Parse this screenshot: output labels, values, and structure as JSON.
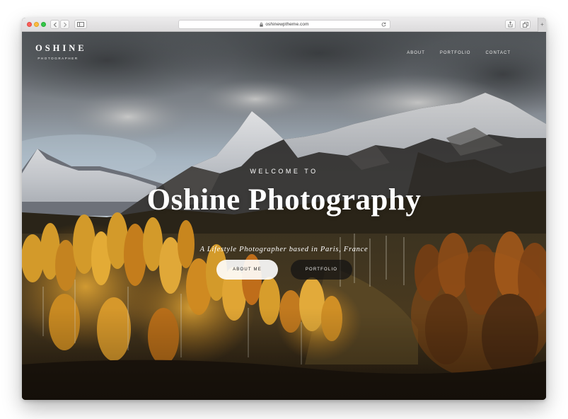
{
  "browser": {
    "url": "oshinewptheme.com",
    "buttons": {
      "back": "chevron-left-icon",
      "forward": "chevron-right-icon",
      "sidebar": "sidebar-icon",
      "share": "share-icon",
      "tabs": "tabs-icon",
      "new_tab": "+"
    }
  },
  "site": {
    "logo": {
      "title": "OSHINE",
      "subtitle": "PHOTOGRAPHER"
    },
    "nav": [
      {
        "label": "ABOUT"
      },
      {
        "label": "PORTFOLIO"
      },
      {
        "label": "CONTACT"
      }
    ]
  },
  "hero": {
    "eyebrow": "WELCOME TO",
    "title": "Oshine Photography",
    "tagline": "A Lifestyle Photographer based in Paris, France",
    "buttons": {
      "primary": "ABOUT ME",
      "secondary": "PORTFOLIO"
    }
  },
  "colors": {
    "sky": "#7d8791",
    "snow": "#e4e6ea",
    "rock": "#3d3c3c",
    "aspen_gold": "#d59a28",
    "aspen_orange": "#b55d16",
    "forest_dark": "#2b2116"
  }
}
